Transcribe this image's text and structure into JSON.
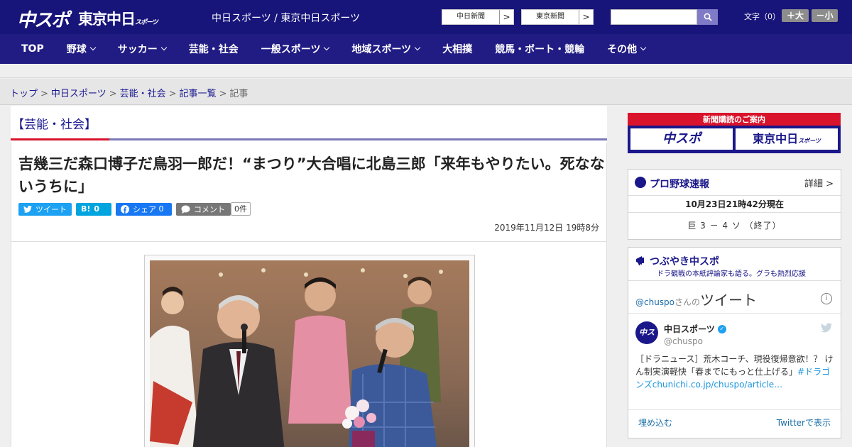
{
  "header": {
    "logo_chuspo": "中スポ",
    "logo_tokyo": "東京中日",
    "logo_tokyo_small": "スポーツ",
    "site_title": "中日スポーツ / 東京中日スポーツ",
    "site_links": [
      {
        "label": "中日新聞",
        "arrow": ">"
      },
      {
        "label": "東京新聞",
        "arrow": ">"
      }
    ],
    "search_placeholder": "",
    "font_size_label": "文字（0）",
    "font_bigger": "＋大",
    "font_smaller": "－小"
  },
  "nav": {
    "items": [
      {
        "label": "TOP",
        "has_menu": false
      },
      {
        "label": "野球",
        "has_menu": true
      },
      {
        "label": "サッカー",
        "has_menu": true
      },
      {
        "label": "芸能・社会",
        "has_menu": false
      },
      {
        "label": "一般スポーツ",
        "has_menu": true
      },
      {
        "label": "地域スポーツ",
        "has_menu": true
      },
      {
        "label": "大相撲",
        "has_menu": false
      },
      {
        "label": "競馬・ボート・競輪",
        "has_menu": false
      },
      {
        "label": "その他",
        "has_menu": true
      }
    ]
  },
  "breadcrumb": {
    "items": [
      "トップ",
      "中日スポーツ",
      "芸能・社会",
      "記事一覧"
    ],
    "separator": ">",
    "current": "記事"
  },
  "article": {
    "category": "【芸能・社会】",
    "headline": "吉幾三だ森口博子だ鳥羽一郎だ！“まつり”大合唱に北島三郎「来年もやりたい。死なないうちに」",
    "share": {
      "tweet": "ツイート",
      "hatena": "B!",
      "hatena_count": "0",
      "facebook": "シェア",
      "facebook_count": "0",
      "comment": "コメント",
      "comment_count": "0件"
    },
    "date": "2019年11月12日 19時8分"
  },
  "sidebar": {
    "ad": {
      "title": "新聞購読のご案内",
      "btn1": "中スポ",
      "btn2": "東京中日",
      "btn2_small": "スポーツ"
    },
    "baseball": {
      "title": "プロ野球速報",
      "detail": "詳細 >",
      "time": "10月23日21時42分現在",
      "score": "巨 3 － 4 ソ （終了）"
    },
    "tweets": {
      "title": "つぶやき中スポ",
      "subtitle": "ドラ観戦の本紙評論家も語る。グラも熱烈応援",
      "handle_at": "@chuspo",
      "handle_san": "さんの",
      "handle_label": "ツイート",
      "account_name": "中日スポーツ",
      "screen_name": "@chuspo",
      "avatar_text": "中スポ",
      "tweet_text": "［ドラニュース］荒木コーチ、現役復帰意欲！？ けん制実演軽快「春までにもっと仕上げる」",
      "tweet_link": "#ドラゴンズchunichi.co.jp/chuspo/article…",
      "embed": "埋め込む",
      "view_on_twitter": "Twitterで表示"
    }
  },
  "colors": {
    "header_bg": "#17147a",
    "nav_bg": "#211b84",
    "accent_red": "#d9132d",
    "link_blue": "#1a1890"
  }
}
